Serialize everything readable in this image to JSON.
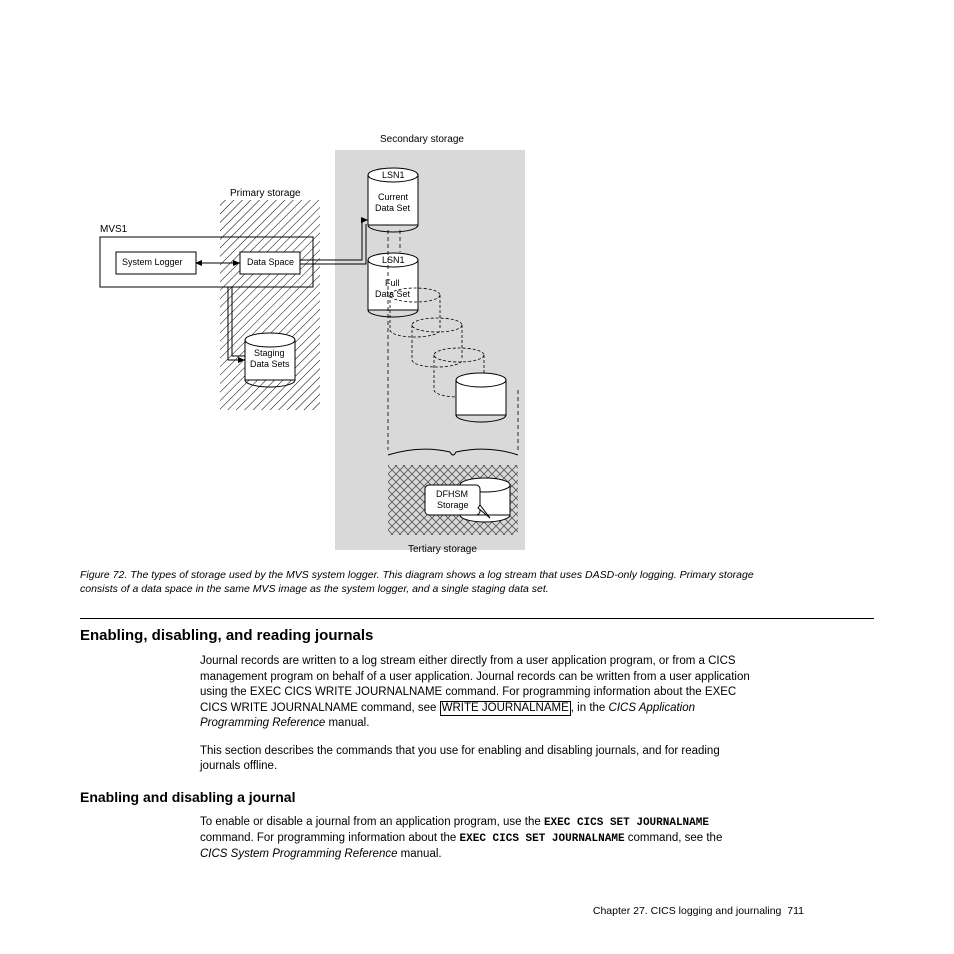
{
  "diagram": {
    "secondary_storage": "Secondary storage",
    "primary_storage": "Primary storage",
    "tertiary_storage": "Tertiary storage",
    "mvs1": "MVS1",
    "system_logger": "System Logger",
    "data_space": "Data Space",
    "lsn1_a": "LSN1",
    "current_ds_1": "Current",
    "current_ds_2": "Data Set",
    "lsn1_b": "LSN1",
    "full_ds_1": "Full",
    "full_ds_2": "Data Set",
    "staging_1": "Staging",
    "staging_2": "Data Sets",
    "dfhsm_1": "DFHSM",
    "dfhsm_2": "Storage"
  },
  "figcaption_prefix": "Figure 72.",
  "figcaption_text": " The types of storage used by the MVS system logger. This diagram shows a log stream that uses DASD-only logging. Primary storage consists of a data space in the same MVS image as the system logger, and a single staging data set.",
  "section1_heading": "Enabling, disabling, and reading journals",
  "section1_p1_a": "Journal records are written to a log stream either directly from a user application program, or from a CICS management program on behalf of a user application. Journal records can be written from a user application using the EXEC CICS WRITE JOURNALNAME command. For programming information about the EXEC CICS WRITE JOURNALNAME command, see ",
  "section1_link": "WRITE JOURNALNAME",
  "section1_p1_b": ", in the ",
  "section1_p1_ital": "CICS Application Programming Reference",
  "section1_p1_c": " manual.",
  "section1_p2": "This section describes the commands that you use for enabling and disabling journals, and for reading journals offline.",
  "section2_heading": "Enabling and disabling a journal",
  "section2_p1_a": "To enable or disable a journal from an application program, use the ",
  "section2_mono1": "EXEC CICS SET JOURNALNAME",
  "section2_p1_b": " command. For programming information about the ",
  "section2_mono2": "EXEC CICS SET JOURNALNAME",
  "section2_p1_c": " command, see the ",
  "section2_p1_ital": "CICS System Programming Reference",
  "section2_p1_d": " manual.",
  "footer_chapter": "Chapter 27. CICS logging and journaling",
  "footer_page": "711"
}
